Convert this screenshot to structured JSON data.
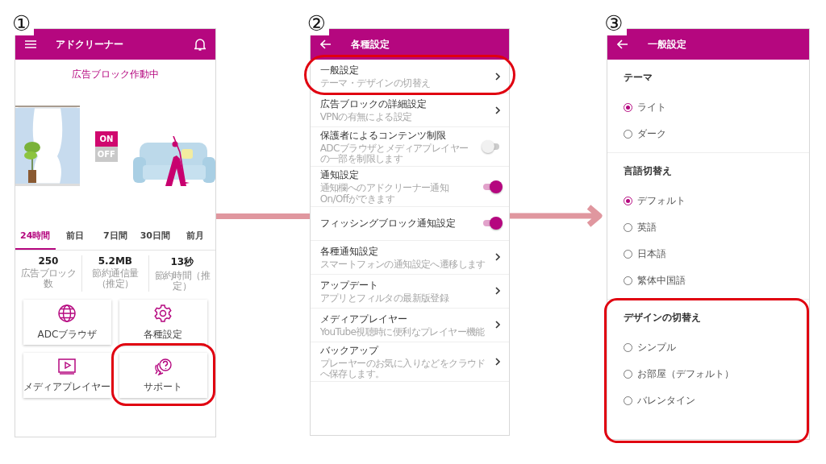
{
  "step_1_home": {
    "badge": "①",
    "app_bar": {
      "title": "アドクリーナー"
    },
    "status_text": "広告ブロック作動中",
    "switch": {
      "on_label": "ON",
      "off_label": "OFF",
      "on": true
    },
    "period_tabs": [
      {
        "label": "24時間",
        "selected": true
      },
      {
        "label": "前日",
        "selected": false
      },
      {
        "label": "7日間",
        "selected": false
      },
      {
        "label": "30日間",
        "selected": false
      },
      {
        "label": "前月",
        "selected": false
      }
    ],
    "stats": [
      {
        "value": "250",
        "label": "広告ブロック数"
      },
      {
        "value": "5.2MB",
        "label": "節約通信量（推定）"
      },
      {
        "value": "13秒",
        "label": "節約時間（推定）"
      }
    ],
    "tiles": [
      {
        "label": "ADCブラウザ",
        "highlighted": false
      },
      {
        "label": "各種設定",
        "highlighted": false
      },
      {
        "label": "メディアプレイヤー",
        "highlighted": false
      },
      {
        "label": "サポート",
        "highlighted": true
      }
    ]
  },
  "step_2_settings": {
    "badge": "②",
    "app_bar": {
      "title": "各種設定"
    },
    "rows": [
      {
        "title": "一般設定",
        "subtitle": "テーマ・デザインの切替え",
        "kind": "link",
        "highlighted": true
      },
      {
        "title": "広告ブロックの詳細設定",
        "subtitle": "VPNの有無による設定",
        "kind": "link",
        "highlighted": false
      },
      {
        "title": "保護者によるコンテンツ制限",
        "subtitle": "ADCブラウザとメディアプレイヤーの一部を制限します",
        "kind": "toggle",
        "on": false,
        "highlighted": false
      },
      {
        "title": "通知設定",
        "subtitle": "通知欄へのアドクリーナー通知On/Offができます",
        "kind": "toggle",
        "on": true,
        "highlighted": false
      },
      {
        "title": "フィッシングブロック通知設定",
        "kind": "toggle",
        "on": true,
        "highlighted": false
      },
      {
        "title": "各種通知設定",
        "subtitle": "スマートフォンの通知設定へ遷移します",
        "kind": "link",
        "highlighted": false
      },
      {
        "title": "アップデート",
        "subtitle": "アプリとフィルタの最新版登録",
        "kind": "link",
        "highlighted": false
      },
      {
        "title": "メディアプレイヤー",
        "subtitle": "YouTube視聴時に便利なプレイヤー機能",
        "kind": "link",
        "highlighted": false
      },
      {
        "title": "バックアップ",
        "subtitle": "プレーヤーのお気に入りなどをクラウドへ保存します。",
        "kind": "link",
        "highlighted": false
      }
    ]
  },
  "step_3_general": {
    "badge": "③",
    "app_bar": {
      "title": "一般設定"
    },
    "sections": [
      {
        "title": "テーマ",
        "highlighted": false,
        "options": [
          {
            "label": "ライト",
            "selected": true
          },
          {
            "label": "ダーク",
            "selected": false
          }
        ]
      },
      {
        "title": "言語切替え",
        "highlighted": false,
        "options": [
          {
            "label": "デフォルト",
            "selected": true
          },
          {
            "label": "英語",
            "selected": false
          },
          {
            "label": "日本語",
            "selected": false
          },
          {
            "label": "繁体中国語",
            "selected": false
          }
        ]
      },
      {
        "title": "デザインの切替え",
        "highlighted": true,
        "options": [
          {
            "label": "シンプル",
            "selected": false
          },
          {
            "label": "お部屋（デフォルト）",
            "selected": false
          },
          {
            "label": "バレンタイン",
            "selected": false
          }
        ]
      }
    ]
  }
}
